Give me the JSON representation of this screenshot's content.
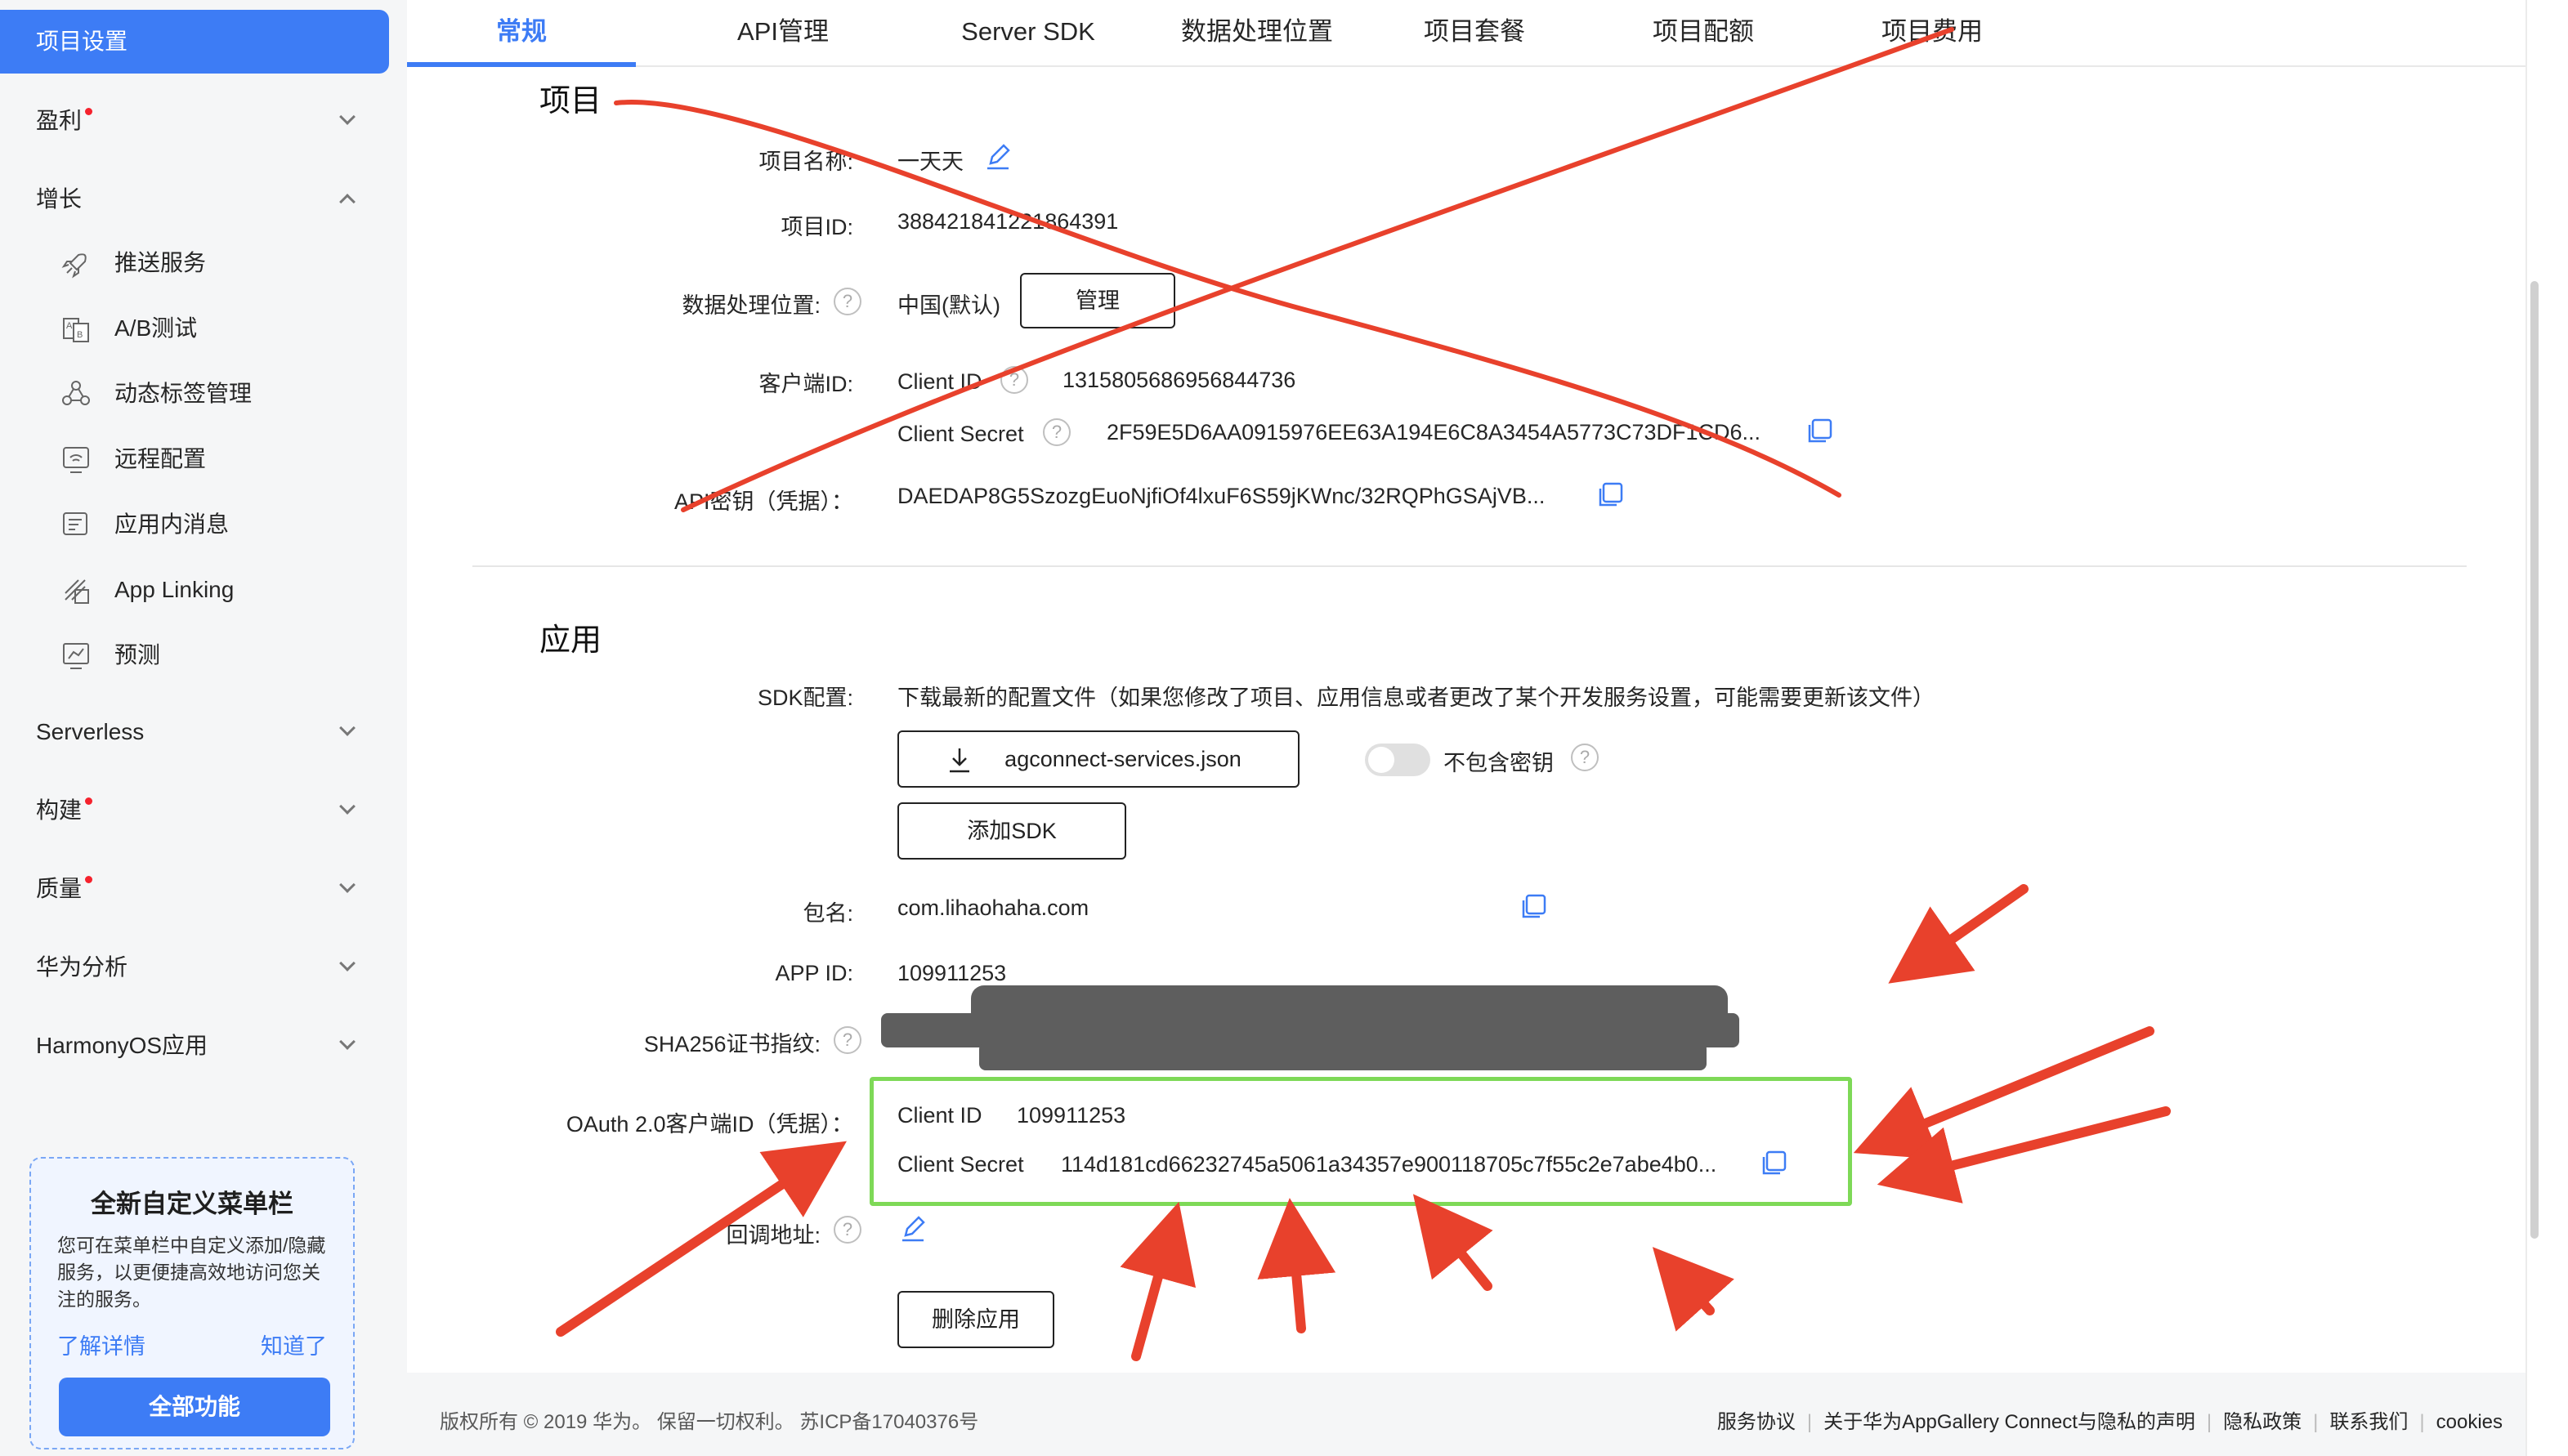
{
  "sidebar": {
    "active_item": "项目设置",
    "groups": {
      "monetize": "盈利",
      "growth": "增长",
      "serverless": "Serverless",
      "build": "构建",
      "quality": "质量",
      "analytics": "华为分析",
      "harmonyos": "HarmonyOS应用"
    },
    "growth_items": [
      "推送服务",
      "A/B测试",
      "动态标签管理",
      "远程配置",
      "应用内消息",
      "App Linking",
      "预测"
    ],
    "promo": {
      "title": "全新自定义菜单栏",
      "text": "您可在菜单栏中自定义添加/隐藏服务，以更便捷高效地访问您关注的服务。",
      "learn_more": "了解详情",
      "got_it": "知道了",
      "all_features": "全部功能"
    }
  },
  "tabs": [
    "常规",
    "API管理",
    "Server SDK",
    "数据处理位置",
    "项目套餐",
    "项目配额",
    "项目费用"
  ],
  "project": {
    "section_title": "项目",
    "name_label": "项目名称:",
    "name_value": "一天天",
    "id_label": "项目ID:",
    "id_value": "388421841221864391",
    "location_label": "数据处理位置:",
    "location_value": "中国(默认)",
    "manage_button": "管理",
    "client_label": "客户端ID:",
    "client_id_label": "Client ID",
    "client_id_value": "131580568695684473​6",
    "client_secret_label": "Client Secret",
    "client_secret_value": "2F59E5D6AA0915976EE63A194E6C8A3454A5773C73DF1CD6...",
    "api_key_label": "API密钥（凭据）：",
    "api_key_value": "DAEDAP8G5SzozgEuoNjfiOf4lxuF6S59jKWnc/32RQPhGSAjVB..."
  },
  "app": {
    "section_title": "应用",
    "sdk_label": "SDK配置:",
    "sdk_desc": "下载最新的配置文件（如果您修改了项目、应用信息或者更改了某个开发服务设置，可能需要更新该文件）",
    "download_button": "agconnect-services.json",
    "exclude_key_label": "不包含密钥",
    "add_sdk_button": "添加SDK",
    "package_label": "包名:",
    "package_value": "com.lihaohaha.com",
    "appid_label": "APP ID:",
    "appid_value": "109911253",
    "sha256_label": "SHA256证书指纹:",
    "oauth_label": "OAuth 2.0客户端ID（凭据）：",
    "oauth_client_id_label": "Client ID",
    "oauth_client_id_value": "109911253",
    "oauth_client_secret_label": "Client Secret",
    "oauth_client_secret_value": "114d181cd66232745a5061a34357e900118705c7f55c2e7abe4b0...",
    "callback_label": "回调地址:",
    "delete_button": "删除应用"
  },
  "footer": {
    "copyright": "版权所有 © 2019 华为。 保留一切权利。 苏ICP备17040376号",
    "links": [
      "服务协议",
      "关于华为AppGallery Connect与隐私的声明",
      "隐私政策",
      "联系我们",
      "cookies"
    ]
  },
  "colors": {
    "accent": "#3d7cf5",
    "annotation_red": "#e8412c",
    "highlight_green": "#7ed957"
  }
}
